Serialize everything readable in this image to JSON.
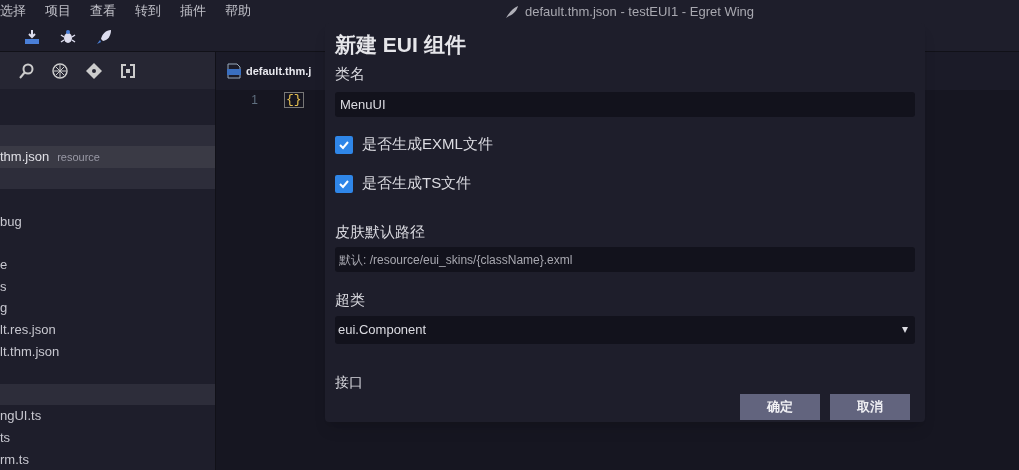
{
  "menu": [
    "选择",
    "项目",
    "查看",
    "转到",
    "插件",
    "帮助"
  ],
  "window": {
    "title": "default.thm.json - testEUI1 - Egret Wing"
  },
  "sidebar": {
    "rows": [
      {
        "kind": "band",
        "label": ""
      },
      {
        "kind": "item",
        "label": "thm.json",
        "detail": "resource",
        "selected": true
      },
      {
        "kind": "band",
        "label": ""
      },
      {
        "kind": "gap",
        "label": ""
      },
      {
        "kind": "item",
        "label": "bug",
        "selected": false
      },
      {
        "kind": "gap",
        "label": ""
      },
      {
        "kind": "item",
        "label": "e",
        "selected": false
      },
      {
        "kind": "item",
        "label": "s",
        "selected": false
      },
      {
        "kind": "item",
        "label": "g",
        "selected": false
      },
      {
        "kind": "item",
        "label": "lt.res.json",
        "selected": false
      },
      {
        "kind": "item",
        "label": "lt.thm.json",
        "selected": false
      },
      {
        "kind": "gap",
        "label": ""
      },
      {
        "kind": "band",
        "label": ""
      },
      {
        "kind": "item",
        "label": "ngUI.ts",
        "selected": false
      },
      {
        "kind": "item",
        "label": "ts",
        "selected": false
      },
      {
        "kind": "item",
        "label": "rm.ts",
        "selected": false
      }
    ]
  },
  "editor": {
    "tab": "default.thm.j",
    "line_number": "1",
    "code": "{}"
  },
  "dialog": {
    "title": "新建 EUI 组件",
    "class_name": {
      "label": "类名",
      "value": "MenuUI"
    },
    "checkboxes": [
      {
        "label": "是否生成EXML文件",
        "checked": true
      },
      {
        "label": "是否生成TS文件",
        "checked": true
      }
    ],
    "skin_path": {
      "label": "皮肤默认路径",
      "placeholder": "默认: /resource/eui_skins/{className}.exml"
    },
    "superclass": {
      "label": "超类",
      "value": "eui.Component"
    },
    "interface": {
      "label": "接口"
    },
    "buttons": [
      "确定",
      "取消"
    ]
  }
}
